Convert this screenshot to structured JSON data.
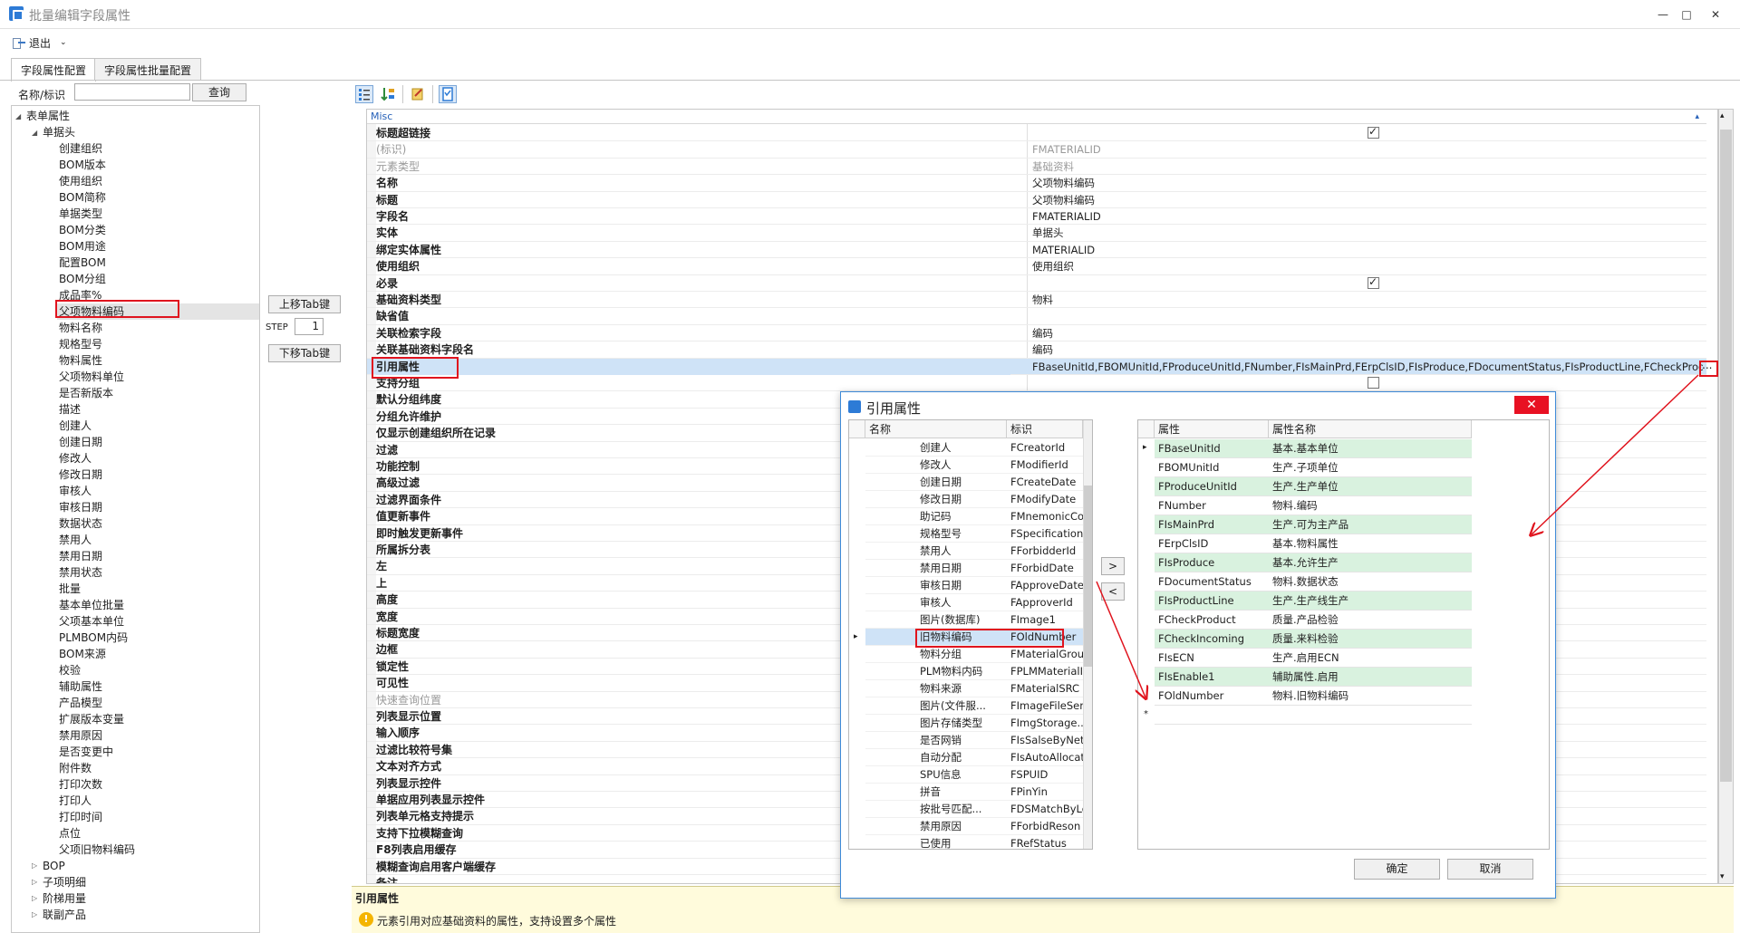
{
  "window": {
    "title": "批量编辑字段属性",
    "minimize": "—",
    "maximize": "□",
    "close": "✕"
  },
  "toolbar": {
    "exit_label": "退出",
    "exit_icon": "exit-icon"
  },
  "tabs": [
    {
      "label": "字段属性配置"
    },
    {
      "label": "字段属性批量配置"
    }
  ],
  "search": {
    "label": "名称/标识",
    "value": "",
    "button": "查询"
  },
  "tree": {
    "root": "表单属性",
    "header_group": "单据头",
    "items": [
      "创建组织",
      "BOM版本",
      "使用组织",
      "BOM简称",
      "单据类型",
      "BOM分类",
      "BOM用途",
      "配置BOM",
      "BOM分组",
      "成品率%",
      "父项物料编码",
      "物料名称",
      "规格型号",
      "物料属性",
      "父项物料单位",
      "是否新版本",
      "描述",
      "创建人",
      "创建日期",
      "修改人",
      "修改日期",
      "审核人",
      "审核日期",
      "数据状态",
      "禁用人",
      "禁用日期",
      "禁用状态",
      "批量",
      "基本单位批量",
      "父项基本单位",
      "PLMBOM内码",
      "BOM来源",
      "校验",
      "辅助属性",
      "产品模型",
      "扩展版本变量",
      "禁用原因",
      "是否变更中",
      "附件数",
      "打印次数",
      "打印人",
      "打印时间",
      "点位",
      "父项旧物料编码"
    ],
    "groups": [
      "BOP",
      "子项明细",
      "阶梯用量",
      "联副产品"
    ]
  },
  "middle": {
    "move_up": "上移Tab键",
    "step_label": "STEP",
    "step_value": "1",
    "move_down": "下移Tab键"
  },
  "property_grid": {
    "category": "Misc",
    "rows": [
      {
        "name": "标题超链接",
        "value": "",
        "check": true
      },
      {
        "name": "(标识)",
        "value": "FMATERIALID",
        "gray": true
      },
      {
        "name": "元素类型",
        "value": "基础资料",
        "gray": true
      },
      {
        "name": "名称",
        "value": "父项物料编码"
      },
      {
        "name": "标题",
        "value": "父项物料编码"
      },
      {
        "name": "字段名",
        "value": "FMATERIALID"
      },
      {
        "name": "实体",
        "value": "单据头"
      },
      {
        "name": "绑定实体属性",
        "value": "MATERIALID"
      },
      {
        "name": "使用组织",
        "value": "使用组织"
      },
      {
        "name": "必录",
        "value": "",
        "check": true
      },
      {
        "name": "基础资料类型",
        "value": "物料"
      },
      {
        "name": "缺省值",
        "value": ""
      },
      {
        "name": "关联检索字段",
        "value": "编码"
      },
      {
        "name": "关联基础资料字段名",
        "value": "编码"
      },
      {
        "name": "引用属性",
        "value": "FBaseUnitId,FBOMUnitId,FProduceUnitId,FNumber,FIsMainPrd,FErpClsID,FIsProduce,FDocumentStatus,FIsProductLine,FCheckProdu...",
        "selected": true
      },
      {
        "name": "支持分组",
        "value": "",
        "check": false
      },
      {
        "name": "默认分组纬度",
        "value": ""
      },
      {
        "name": "分组允许维护",
        "value": ""
      },
      {
        "name": "仅显示创建组织所在记录",
        "value": ""
      },
      {
        "name": "过滤",
        "value": ""
      },
      {
        "name": "功能控制",
        "value": ""
      },
      {
        "name": "高级过滤",
        "value": ""
      },
      {
        "name": "过滤界面条件",
        "value": ""
      },
      {
        "name": "值更新事件",
        "value": ""
      },
      {
        "name": "即时触发更新事件",
        "value": ""
      },
      {
        "name": "所属拆分表",
        "value": ""
      },
      {
        "name": "左",
        "value": ""
      },
      {
        "name": "上",
        "value": ""
      },
      {
        "name": "高度",
        "value": ""
      },
      {
        "name": "宽度",
        "value": ""
      },
      {
        "name": "标题宽度",
        "value": ""
      },
      {
        "name": "边框",
        "value": ""
      },
      {
        "name": "锁定性",
        "value": ""
      },
      {
        "name": "可见性",
        "value": ""
      },
      {
        "name": "快速查询位置",
        "value": "",
        "gray": true
      },
      {
        "name": "列表显示位置",
        "value": ""
      },
      {
        "name": "输入顺序",
        "value": ""
      },
      {
        "name": "过滤比较符号集",
        "value": ""
      },
      {
        "name": "文本对齐方式",
        "value": ""
      },
      {
        "name": "列表显示控件",
        "value": ""
      },
      {
        "name": "单据应用列表显示控件",
        "value": ""
      },
      {
        "name": "列表单元格支持提示",
        "value": ""
      },
      {
        "name": "支持下拉模糊查询",
        "value": ""
      },
      {
        "name": "F8列表启用缓存",
        "value": ""
      },
      {
        "name": "模糊查询启用客户端缓存",
        "value": ""
      },
      {
        "name": "备注",
        "value": ""
      }
    ],
    "ellipsis": "..."
  },
  "help": {
    "title": "引用属性",
    "text": "元素引用对应基础资料的属性，支持设置多个属性",
    "icon": "info-icon"
  },
  "dialog": {
    "title": "引用属性",
    "close": "✕",
    "left_headers": [
      "名称",
      "标识"
    ],
    "left_rows": [
      {
        "name": "创建人",
        "id": "FCreatorId"
      },
      {
        "name": "修改人",
        "id": "FModifierId"
      },
      {
        "name": "创建日期",
        "id": "FCreateDate"
      },
      {
        "name": "修改日期",
        "id": "FModifyDate"
      },
      {
        "name": "助记码",
        "id": "FMnemonicCo..."
      },
      {
        "name": "规格型号",
        "id": "FSpecification"
      },
      {
        "name": "禁用人",
        "id": "FForbidderId"
      },
      {
        "name": "禁用日期",
        "id": "FForbidDate"
      },
      {
        "name": "审核日期",
        "id": "FApproveDate"
      },
      {
        "name": "审核人",
        "id": "FApproverId"
      },
      {
        "name": "图片(数据库)",
        "id": "FImage1"
      },
      {
        "name": "旧物料编码",
        "id": "FOldNumber",
        "selected": true
      },
      {
        "name": "物料分组",
        "id": "FMaterialGroup"
      },
      {
        "name": "PLM物料内码",
        "id": "FPLMMaterialId"
      },
      {
        "name": "物料来源",
        "id": "FMaterialSRC"
      },
      {
        "name": "图片(文件服...",
        "id": "FImageFileSer..."
      },
      {
        "name": "图片存储类型",
        "id": "FImgStorage..."
      },
      {
        "name": "是否网销",
        "id": "FIsSalseByNet"
      },
      {
        "name": "自动分配",
        "id": "FIsAutoAllocate"
      },
      {
        "name": "SPU信息",
        "id": "FSPUID"
      },
      {
        "name": "拼音",
        "id": "FPinYin"
      },
      {
        "name": "按批号匹配...",
        "id": "FDSMatchByLot"
      },
      {
        "name": "禁用原因",
        "id": "FForbidReson"
      },
      {
        "name": "已使用",
        "id": "FRefStatus"
      }
    ],
    "right_headers": [
      "属性",
      "属性名称"
    ],
    "right_rows": [
      {
        "attr": "FBaseUnitId",
        "name": "基本.基本单位",
        "green": true
      },
      {
        "attr": "FBOMUnitId",
        "name": "生产.子项单位",
        "green": false
      },
      {
        "attr": "FProduceUnitId",
        "name": "生产.生产单位",
        "green": true
      },
      {
        "attr": "FNumber",
        "name": "物料.编码",
        "green": false
      },
      {
        "attr": "FIsMainPrd",
        "name": "生产.可为主产品",
        "green": true
      },
      {
        "attr": "FErpClsID",
        "name": "基本.物料属性",
        "green": false
      },
      {
        "attr": "FIsProduce",
        "name": "基本.允许生产",
        "green": true
      },
      {
        "attr": "FDocumentStatus",
        "name": "物料.数据状态",
        "green": false
      },
      {
        "attr": "FIsProductLine",
        "name": "生产.生产线生产",
        "green": true
      },
      {
        "attr": "FCheckProduct",
        "name": "质量.产品检验",
        "green": false
      },
      {
        "attr": "FCheckIncoming",
        "name": "质量.来料检验",
        "green": true
      },
      {
        "attr": "FIsECN",
        "name": "生产.启用ECN",
        "green": false
      },
      {
        "attr": "FIsEnable1",
        "name": "辅助属性.启用",
        "green": true
      },
      {
        "attr": "FOldNumber",
        "name": "物料.旧物料编码",
        "green": false
      }
    ],
    "add_btn": ">",
    "remove_btn": "<",
    "ok": "确定",
    "cancel": "取消",
    "new_row_marker": "*",
    "current_row_marker": "▸"
  },
  "colors": {
    "accent": "#2d7bd6",
    "highlight_red": "#e0141e",
    "green_row": "#d9f2df",
    "selected_row": "#cfe3f7"
  }
}
